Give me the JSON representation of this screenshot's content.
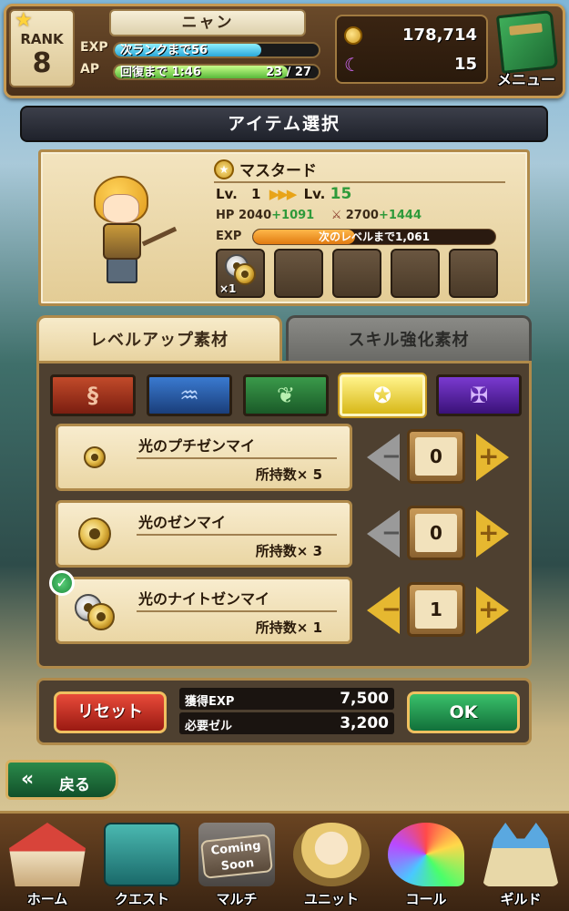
{
  "hud": {
    "rank_label": "RANK",
    "rank_value": "8",
    "player_name": "ニャン",
    "exp_label": "EXP",
    "exp_text": "次ランクまで56",
    "exp_fill": 0.72,
    "ap_label": "AP",
    "ap_text": "回復まで 1:46",
    "ap_count": "23 / 27",
    "ap_fill": 0.85,
    "zel": "178,714",
    "crystals": "15",
    "menu_label": "メニュー"
  },
  "title": "アイテム選択",
  "character": {
    "name": "マスタード",
    "lv_label": "Lv.",
    "lv_from": "1",
    "lv_arrows": "▶▶▶",
    "lv_to_label": "Lv.",
    "lv_to": "15",
    "hp_label": "HP",
    "hp_base": "2040",
    "hp_plus": "+1091",
    "atk_base": "2700",
    "atk_plus": "+1444",
    "exp_label": "EXP",
    "exp_text": "次のレベルまで1,061",
    "exp_fill": 0.42,
    "slot_count": "×1"
  },
  "tabs": {
    "levelup": "レベルアップ素材",
    "skill": "スキル強化素材"
  },
  "elements": [
    "fire",
    "water",
    "wood",
    "light",
    "dark"
  ],
  "items": [
    {
      "name": "光のプチゼンマイ",
      "owned_label": "所持数×",
      "owned": "5",
      "qty": "0"
    },
    {
      "name": "光のゼンマイ",
      "owned_label": "所持数×",
      "owned": "3",
      "qty": "0"
    },
    {
      "name": "光のナイトゼンマイ",
      "owned_label": "所持数×",
      "owned": "1",
      "qty": "1"
    }
  ],
  "action": {
    "reset_label": "リセット",
    "gain_exp_label": "獲得EXP",
    "gain_exp_value": "7,500",
    "cost_label": "必要ゼル",
    "cost_value": "3,200",
    "ok_label": "OK"
  },
  "back_label": "戻る",
  "nav": {
    "home": "ホーム",
    "quest": "クエスト",
    "multi": "マルチ",
    "multi_badge_1": "Coming",
    "multi_badge_2": "Soon",
    "unit": "ユニット",
    "call": "コール",
    "guild": "ギルド"
  }
}
